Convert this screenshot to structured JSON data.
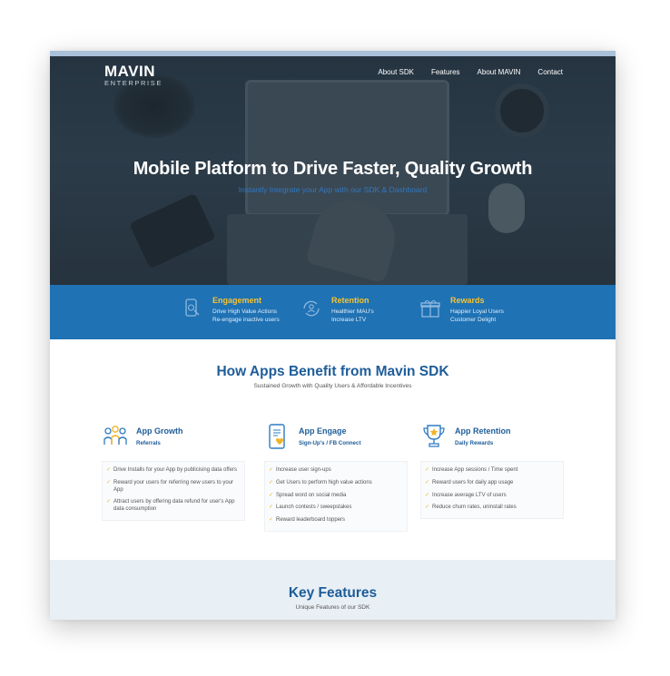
{
  "brand": {
    "name": "MAVIN",
    "sub": "ENTERPRISE"
  },
  "nav": {
    "items": [
      "About SDK",
      "Features",
      "About MAVIN",
      "Contact"
    ]
  },
  "hero": {
    "title": "Mobile Platform to Drive Faster, Quality Growth",
    "subtitle": "Instantly Integrate your App with our SDK & Dashboard"
  },
  "band": {
    "items": [
      {
        "title": "Engagement",
        "lines": [
          "Drive High Value Actions",
          "Re-engage inactive users"
        ],
        "icon": "phone-touch-icon"
      },
      {
        "title": "Retention",
        "lines": [
          "Healthier MAU's",
          "Increase LTV"
        ],
        "icon": "refresh-user-icon"
      },
      {
        "title": "Rewards",
        "lines": [
          "Happier Loyal Users",
          "Customer Delight"
        ],
        "icon": "gift-icon"
      }
    ]
  },
  "benefits": {
    "title": "How Apps Benefit from Mavin SDK",
    "subtitle": "Sustained Growth with Quality Users & Affordable Incentives",
    "columns": [
      {
        "title": "App Growth",
        "tag": "Referrals",
        "icon": "users-group-icon",
        "items": [
          "Drive Installs for your App by publicising data offers",
          "Reward your users for referring new users to your App",
          "Attract users by offering data refund for user's App data consumption"
        ]
      },
      {
        "title": "App Engage",
        "tag": "Sign-Up's / FB Connect",
        "icon": "mobile-heart-icon",
        "items": [
          "Increase user sign-ups",
          "Get Users to perform high value actions",
          "Spread word on social media",
          "Launch contests / sweepstakes",
          "Reward leaderboard toppers"
        ]
      },
      {
        "title": "App Retention",
        "tag": "Daily Rewards",
        "icon": "trophy-icon",
        "items": [
          "Increase App sessions / Time spent",
          "Reward users for daily app usage",
          "Increase average LTV of users",
          "Reduce churn rates, uninstall rates"
        ]
      }
    ]
  },
  "features": {
    "title": "Key Features",
    "subtitle": "Unique Features of our SDK"
  },
  "colors": {
    "primary": "#1f72b4",
    "heading": "#1e5d99",
    "accent": "#f7c331",
    "hero_bg": "#26333e"
  }
}
